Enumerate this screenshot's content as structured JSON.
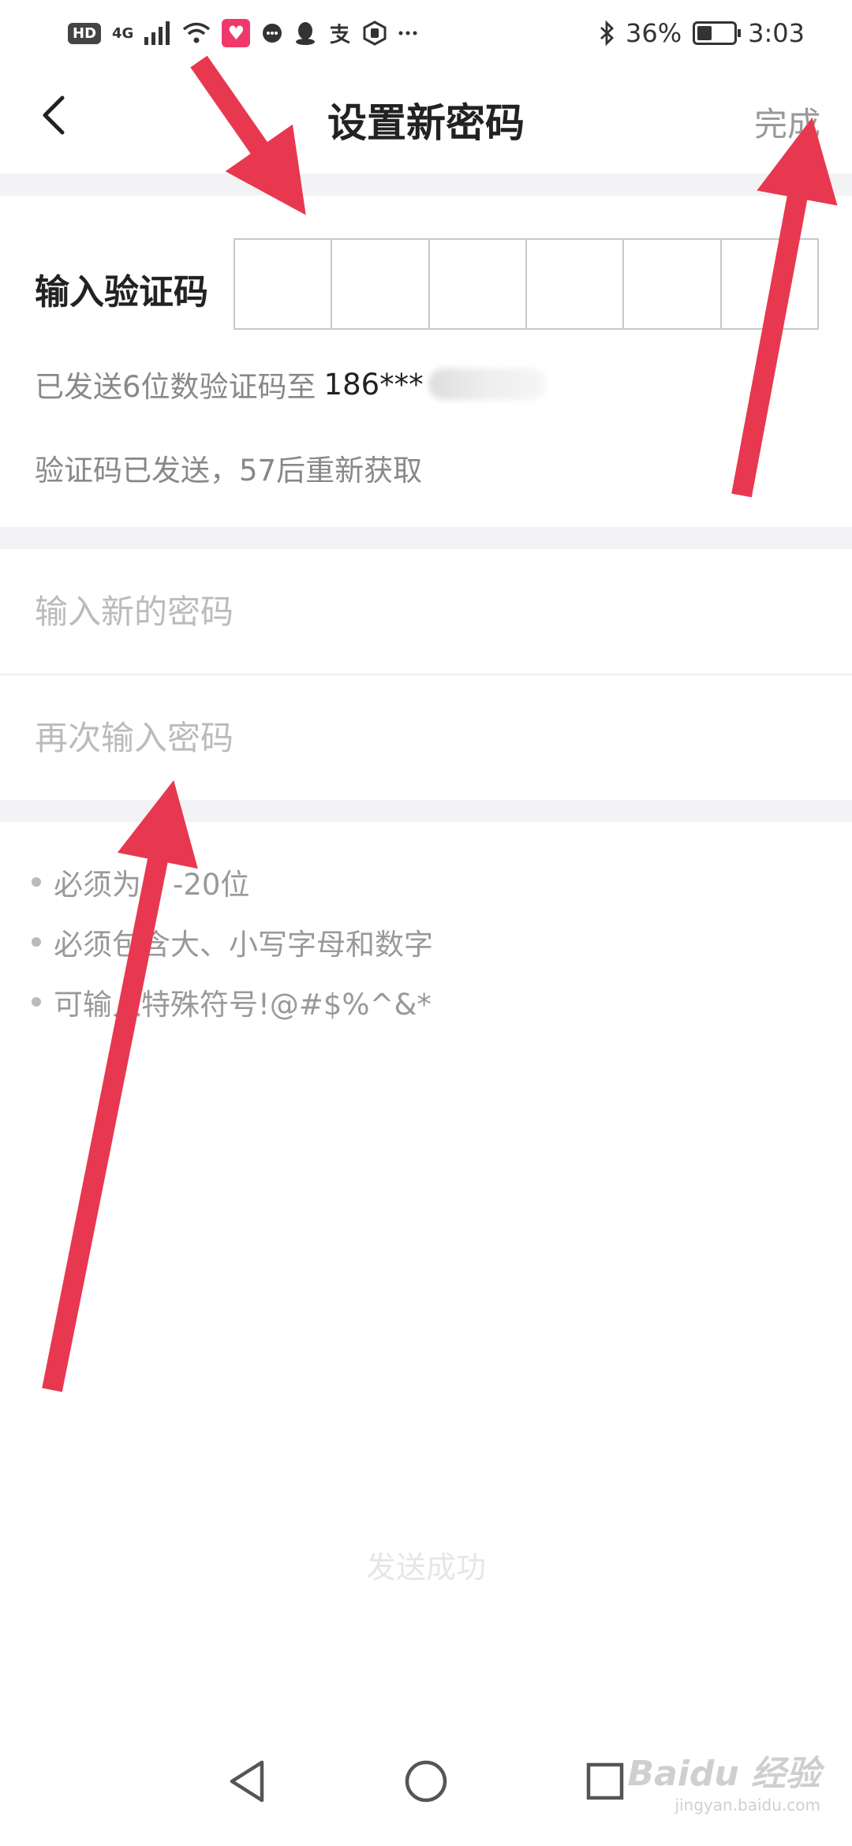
{
  "status_bar": {
    "hd": "HD",
    "network": "4G",
    "battery": "36%",
    "time": "3:03",
    "icons": [
      "signal-icon",
      "wifi-icon",
      "health-app-icon",
      "message-icon",
      "qq-icon",
      "alipay-icon",
      "hand-icon",
      "more-icon",
      "bluetooth-icon",
      "battery-icon"
    ]
  },
  "header": {
    "title": "设置新密码",
    "done_label": "完成"
  },
  "verification": {
    "label": "输入验证码",
    "code_length": 6,
    "sent_prefix": "已发送6位数验证码至",
    "phone_visible": "186***",
    "countdown": "验证码已发送，57后重新获取"
  },
  "password": {
    "new_placeholder": "输入新的密码",
    "confirm_placeholder": "再次输入密码"
  },
  "rules": [
    "必须为",
    "-20位",
    "必须包含大、小写字母和数字",
    "可输入特殊符号!@#$%^&*"
  ],
  "toast": "发送成功",
  "watermark": {
    "logo": "Baidu 经验",
    "url": "jingyan.baidu.com"
  },
  "colors": {
    "annotation_arrow": "#e8384f",
    "section_gap": "#f3f3f6",
    "muted_text": "#888888"
  }
}
